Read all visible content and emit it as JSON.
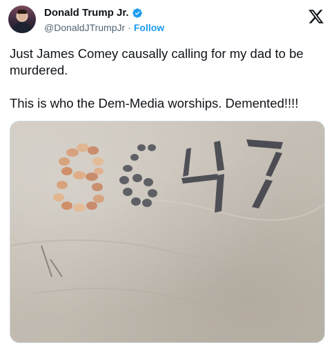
{
  "author": {
    "display_name": "Donald Trump Jr.",
    "handle": "@DonaldJTrumpJr",
    "separator": "·",
    "follow_label": "Follow",
    "verified": true
  },
  "icons": {
    "verified": "verified-badge-icon",
    "brand": "x-logo-icon"
  },
  "tweet": {
    "paragraph_1": "Just James Comey causally calling for my dad to be murdered.",
    "paragraph_2": "This is who the Dem-Media worships. Demented!!!!"
  },
  "media": {
    "kind": "photo",
    "shown_number": "8647"
  },
  "colors": {
    "accent": "#1d9bf0",
    "text": "#0f1419",
    "secondary": "#536471"
  }
}
